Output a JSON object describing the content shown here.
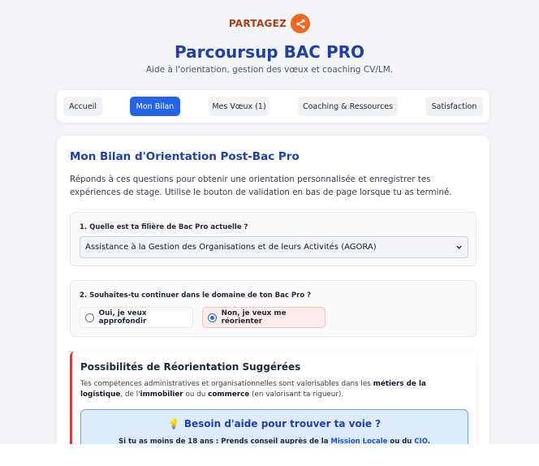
{
  "header": {
    "share_label": "PARTAGEZ",
    "title": "Parcoursup BAC PRO",
    "subtitle": "Aide à l'orientation, gestion des vœux et coaching CV/LM."
  },
  "nav": {
    "tabs": [
      {
        "label": "Accueil",
        "active": false
      },
      {
        "label": "Mon Bilan",
        "active": true
      },
      {
        "label": "Mes Vœux (1)",
        "active": false
      },
      {
        "label": "Coaching & Ressources",
        "active": false
      },
      {
        "label": "Satisfaction",
        "active": false
      }
    ]
  },
  "bilan": {
    "title": "Mon Bilan d'Orientation Post-Bac Pro",
    "intro": "Réponds à ces questions pour obtenir une orientation personnalisée et enregistrer tes expériences de stage. Utilise le bouton de validation en bas de page lorsque tu as terminé.",
    "q1": {
      "label": "1. Quelle est ta filière de Bac Pro actuelle ?",
      "selected": "Assistance à la Gestion des Organisations et de leurs Activités (AGORA)"
    },
    "q2": {
      "label": "2. Souhaites-tu continuer dans le domaine de ton Bac Pro ?",
      "options": [
        {
          "label": "Oui, je veux approfondir",
          "checked": false
        },
        {
          "label": "Non, je veux me réorienter",
          "checked": true
        }
      ]
    },
    "reorientation": {
      "title": "Possibilités de Réorientation Suggérées",
      "text_1": "Tes compétences administratives et organisationnelles sont valorisables dans les ",
      "bold_1": "métiers de la logistique",
      "text_2": ", de l'",
      "bold_2": "immobilier",
      "text_3": " ou du ",
      "bold_3": "commerce",
      "text_4": " (en valorisant ta rigueur)."
    },
    "help": {
      "icon": "💡",
      "title": "Besoin d'aide pour trouver ta voie ?",
      "text_1": "Si tu as moins de 18 ans : Prends conseil auprès de la ",
      "link_1": "Mission Locale",
      "text_2": " ou du ",
      "link_2": "CIO",
      "text_3": "."
    }
  },
  "colors": {
    "accent": "#2563eb",
    "title_blue": "#1e40af",
    "share_orange": "#f26522",
    "alert_red": "#e23a3a"
  }
}
